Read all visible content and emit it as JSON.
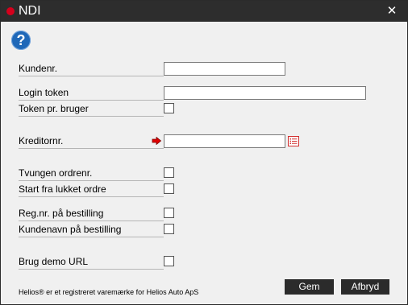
{
  "window": {
    "title": "NDI",
    "close_glyph": "✕",
    "accent_color": "#d6001c",
    "titlebar_color": "#2d2d2d"
  },
  "help": {
    "icon": "help-icon",
    "glyph": "?"
  },
  "fields": {
    "kundenr": {
      "label": "Kundenr.",
      "value": ""
    },
    "login_token": {
      "label": "Login token",
      "value": ""
    },
    "token_pr_bruger": {
      "label": "Token pr. bruger",
      "checked": false
    },
    "kreditornr": {
      "label": "Kreditornr.",
      "value": "",
      "arrow_icon": "arrow-right-icon",
      "lookup_icon": "list-icon"
    },
    "tvungen_ordrenr": {
      "label": "Tvungen ordrenr.",
      "checked": false
    },
    "start_fra_lukket_ordre": {
      "label": "Start fra lukket ordre",
      "checked": false
    },
    "regnr_paa_bestilling": {
      "label": "Reg.nr. på bestilling",
      "checked": false
    },
    "kundenavn_paa_bestilling": {
      "label": "Kundenavn på bestilling",
      "checked": false
    },
    "brug_demo_url": {
      "label": "Brug demo URL",
      "checked": false
    }
  },
  "footer": {
    "note": "Helios® er et registreret varemærke for Helios Auto ApS",
    "save_label": "Gem",
    "cancel_label": "Afbryd"
  }
}
